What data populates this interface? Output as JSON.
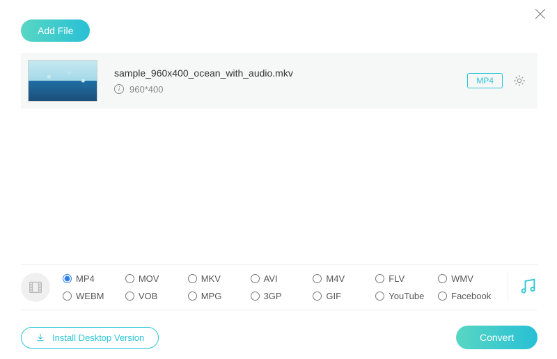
{
  "header": {
    "add_file_label": "Add File"
  },
  "file": {
    "name": "sample_960x400_ocean_with_audio.mkv",
    "resolution": "960*400",
    "target_format": "MP4"
  },
  "formats": {
    "selected": "MP4",
    "options": [
      "MP4",
      "MOV",
      "MKV",
      "AVI",
      "M4V",
      "FLV",
      "WMV",
      "WEBM",
      "VOB",
      "MPG",
      "3GP",
      "GIF",
      "YouTube",
      "Facebook"
    ]
  },
  "footer": {
    "install_label": "Install Desktop Version",
    "convert_label": "Convert"
  },
  "colors": {
    "accent": "#2ac6d6"
  }
}
